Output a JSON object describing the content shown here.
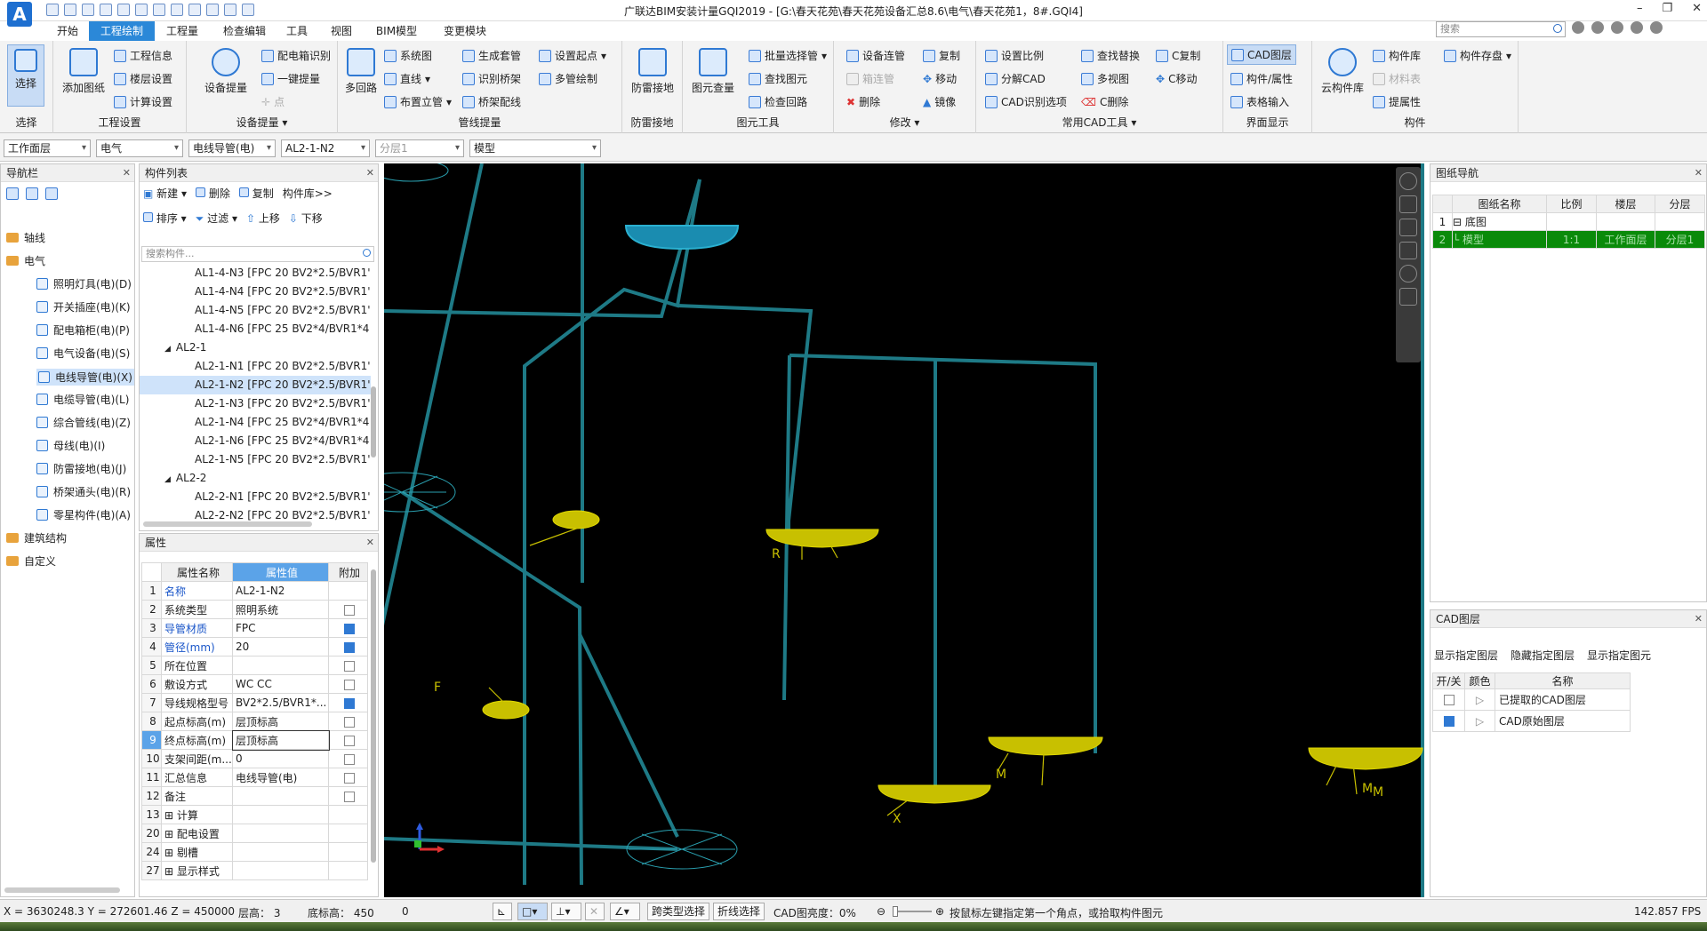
{
  "app": {
    "title": "广联达BIM安装计量GQI2019 - [G:\\春天花苑\\春天花苑设备汇总8.6\\电气\\春天花苑1，8#.GQI4]",
    "search_placeholder": "搜索",
    "logo": "A"
  },
  "menu": [
    "开始",
    "工程绘制",
    "工程量",
    "检查编辑",
    "工具",
    "视图",
    "BIM模型",
    "变更模块"
  ],
  "menu_active": "工程绘制",
  "ribbon": {
    "select": {
      "label": "选择",
      "group": "选择"
    },
    "project": {
      "add_drawing": "添加图纸",
      "info": "工程信息",
      "floor": "楼层设置",
      "calc": "计算设置",
      "group": "工程设置"
    },
    "device": {
      "big": "设备提量",
      "b1": "配电箱识别",
      "b2": "一键提量",
      "b3": "点",
      "group": "设备提量"
    },
    "pipe": {
      "big": "多回路",
      "b1": "系统图",
      "b2": "直线",
      "b3": "布置立管",
      "c1": "生成套管",
      "c2": "识别桥架",
      "c3": "桥架配线",
      "d1": "设置起点",
      "d2": "多管绘制",
      "group": "管线提量"
    },
    "lightning": {
      "big": "防雷接地",
      "group": "防雷接地"
    },
    "element": {
      "big": "图元查量",
      "b1": "批量选择管",
      "b2": "查找图元",
      "b3": "检查回路",
      "group": "图元工具"
    },
    "modify": {
      "b1": "设备连管",
      "b2": "箱连管",
      "b3": "删除",
      "c1": "复制",
      "c2": "移动",
      "c3": "镜像",
      "group": "修改"
    },
    "cad": {
      "b1": "设置比例",
      "b2": "分解CAD",
      "b3": "CAD识别选项",
      "c1": "查找替换",
      "c2": "多视图",
      "c3": "C删除",
      "d1": "C复制",
      "d2": "C移动",
      "group": "常用CAD工具"
    },
    "ui": {
      "b1": "CAD图层",
      "b2": "构件/属性",
      "b3": "表格输入",
      "group": "界面显示"
    },
    "component": {
      "big": "云构件库",
      "b1": "构件库",
      "b2": "材料表",
      "b3": "提属性",
      "c1": "构件存盘",
      "group": "构件"
    }
  },
  "combos": [
    "工作面层",
    "电气",
    "电线导管(电)",
    "AL2-1-N2",
    "分层1",
    "模型"
  ],
  "nav": {
    "title": "导航栏",
    "items": [
      "轴线",
      "电气",
      "照明灯具(电)(D)",
      "开关插座(电)(K)",
      "配电箱柜(电)(P)",
      "电气设备(电)(S)",
      "电线导管(电)(X)",
      "电缆导管(电)(L)",
      "综合管线(电)(Z)",
      "母线(电)(I)",
      "防雷接地(电)(J)",
      "桥架通头(电)(R)",
      "零星构件(电)(A)",
      "建筑结构",
      "自定义"
    ]
  },
  "comp_list": {
    "title": "构件列表",
    "new": "新建",
    "delete": "删除",
    "copy": "复制",
    "lib": "构件库>>",
    "sort": "排序",
    "filter": "过滤",
    "up": "上移",
    "down": "下移",
    "search_placeholder": "搜索构件...",
    "rows": [
      "AL1-4-N3 [FPC 20 BV2*2.5/BVR1'",
      "AL1-4-N4 [FPC 20 BV2*2.5/BVR1'",
      "AL1-4-N5 [FPC 20 BV2*2.5/BVR1'",
      "AL1-4-N6 [FPC 25 BV2*4/BVR1*4",
      "AL2-1",
      "AL2-1-N1 [FPC 20 BV2*2.5/BVR1'",
      "AL2-1-N2 [FPC 20 BV2*2.5/BVR1'",
      "AL2-1-N3 [FPC 20 BV2*2.5/BVR1'",
      "AL2-1-N4 [FPC 25 BV2*4/BVR1*4",
      "AL2-1-N6 [FPC 25 BV2*4/BVR1*4",
      "AL2-1-N5 [FPC 20 BV2*2.5/BVR1'",
      "AL2-2",
      "AL2-2-N1 [FPC 20 BV2*2.5/BVR1'",
      "AL2-2-N2 [FPC 20 BV2*2.5/BVR1'"
    ]
  },
  "props": {
    "title": "属性",
    "h_name": "属性名称",
    "h_value": "属性值",
    "h_extra": "附加",
    "rows": [
      {
        "no": "1",
        "name": "名称",
        "value": "AL2-1-N2",
        "blue": true,
        "chk": null
      },
      {
        "no": "2",
        "name": "系统类型",
        "value": "照明系统",
        "blue": false,
        "chk": false
      },
      {
        "no": "3",
        "name": "导管材质",
        "value": "FPC",
        "blue": true,
        "chk": true
      },
      {
        "no": "4",
        "name": "管径(mm)",
        "value": "20",
        "blue": true,
        "chk": true
      },
      {
        "no": "5",
        "name": "所在位置",
        "value": "",
        "blue": false,
        "chk": false
      },
      {
        "no": "6",
        "name": "敷设方式",
        "value": "WC CC",
        "blue": false,
        "chk": false
      },
      {
        "no": "7",
        "name": "导线规格型号",
        "value": "BV2*2.5/BVR1*...",
        "blue": false,
        "chk": true
      },
      {
        "no": "8",
        "name": "起点标高(m)",
        "value": "层顶标高",
        "blue": false,
        "chk": false
      },
      {
        "no": "9",
        "name": "终点标高(m)",
        "value": "层顶标高",
        "blue": false,
        "chk": false
      },
      {
        "no": "10",
        "name": "支架间距(m...",
        "value": "0",
        "blue": false,
        "chk": false
      },
      {
        "no": "11",
        "name": "汇总信息",
        "value": "电线导管(电)",
        "blue": false,
        "chk": false
      },
      {
        "no": "12",
        "name": "备注",
        "value": "",
        "blue": false,
        "chk": false
      },
      {
        "no": "13",
        "name": "⊞ 计算",
        "value": "",
        "blue": false,
        "chk": null
      },
      {
        "no": "20",
        "name": "⊞ 配电设置",
        "value": "",
        "blue": false,
        "chk": null
      },
      {
        "no": "24",
        "name": "⊞ 剔槽",
        "value": "",
        "blue": false,
        "chk": null
      },
      {
        "no": "27",
        "name": "⊞ 显示样式",
        "value": "",
        "blue": false,
        "chk": null
      }
    ]
  },
  "drawing_nav": {
    "title": "图纸导航",
    "headers": [
      "",
      "图纸名称",
      "比例",
      "楼层",
      "分层"
    ],
    "rows": [
      [
        "1",
        "⊟ 底图",
        "",
        "",
        ""
      ],
      [
        "2",
        "└ 模型",
        "1:1",
        "工作面层",
        "分层1"
      ]
    ]
  },
  "cad_layers": {
    "title": "CAD图层",
    "show_layer": "显示指定图层",
    "hide_layer": "隐藏指定图层",
    "show_elem": "显示指定图元",
    "headers": [
      "开/关",
      "颜色",
      "名称"
    ],
    "rows": [
      {
        "on": false,
        "name": "已提取的CAD图层"
      },
      {
        "on": true,
        "name": "CAD原始图层"
      }
    ]
  },
  "status": {
    "coords": "X = 3630248.3 Y = 272601.46 Z = 450000",
    "floor_h": "层高：  3",
    "base_h": "底标高：  450",
    "zero": "0",
    "cross_select": "跨类型选择",
    "poly_select": "折线选择",
    "cad_brightness": "CAD图亮度：0%",
    "hint": "按鼠标左键指定第一个角点，或拾取构件图元",
    "fps": "142.857 FPS"
  },
  "viewport_labels": [
    "R",
    "M",
    "F",
    "M",
    "X",
    "M"
  ],
  "colors": {
    "accent": "#2b88d8",
    "pipe": "#1e7a86",
    "fixture": "#c8c000",
    "selected_fixture": "#1a8cb0",
    "drawing_green": "#0a8a0a"
  }
}
